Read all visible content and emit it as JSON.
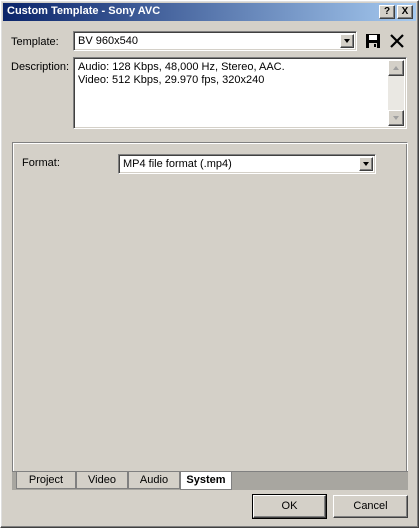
{
  "window": {
    "title": "Custom Template - Sony AVC"
  },
  "titlebar": {
    "help_label": "?",
    "close_label": "X"
  },
  "template": {
    "label": "Template:",
    "value": "BV 960x540"
  },
  "description": {
    "label": "Description:",
    "line1": "Audio: 128 Kbps, 48,000 Hz, Stereo, AAC.",
    "line2": "Video: 512 Kbps, 29.970 fps, 320x240"
  },
  "format": {
    "label": "Format:",
    "value": "MP4 file format (.mp4)"
  },
  "tabs": [
    {
      "label": "Project"
    },
    {
      "label": "Video"
    },
    {
      "label": "Audio"
    },
    {
      "label": "System",
      "active": true
    }
  ],
  "buttons": {
    "ok": "OK",
    "cancel": "Cancel"
  }
}
